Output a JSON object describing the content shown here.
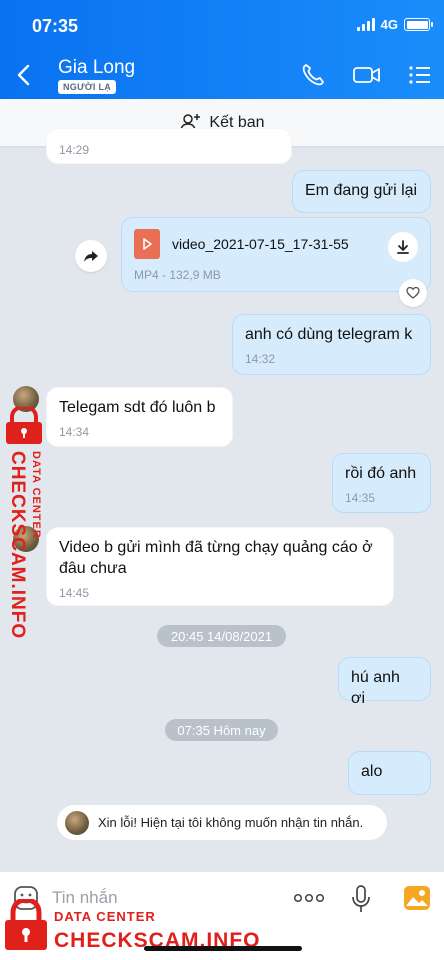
{
  "status_bar": {
    "time": "07:35",
    "network": "4G"
  },
  "header": {
    "contact_name": "Gia Long",
    "stranger_tag": "NGƯỜI LẠ"
  },
  "add_friend": {
    "label": "Kết bạn"
  },
  "messages": [
    {
      "text": "14:29"
    },
    {
      "text": "Em đang gửi lại"
    },
    {
      "file_name": "video_2021-07-15_17-31-55",
      "file_meta": "MP4 - 132,9 MB"
    },
    {
      "text": "anh có dùng telegram k",
      "time": "14:32"
    },
    {
      "text": "Telegam sdt đó luôn b",
      "time": "14:34"
    },
    {
      "text": "rồi đó anh",
      "time": "14:35"
    },
    {
      "text": "Video b gửi mình đã từng chạy quảng cáo ở đâu chưa",
      "time": "14:45"
    },
    {
      "text": "hú anh ơi"
    },
    {
      "text": "alo"
    }
  ],
  "date_separators": [
    "20:45 14/08/2021",
    "07:35 Hôm nay"
  ],
  "system_message": "Xin lỗi! Hiện tại tôi không muốn nhận tin nhắn.",
  "composer": {
    "placeholder": "Tin nhắn"
  },
  "watermark": {
    "line1": "DATA CENTER",
    "line2": "CHECKSCAM.INFO"
  },
  "colors": {
    "header": "#0a72f0",
    "outgoing": "#d6ecfd",
    "background": "#e2e7ee",
    "watermark": "#e0201b"
  }
}
